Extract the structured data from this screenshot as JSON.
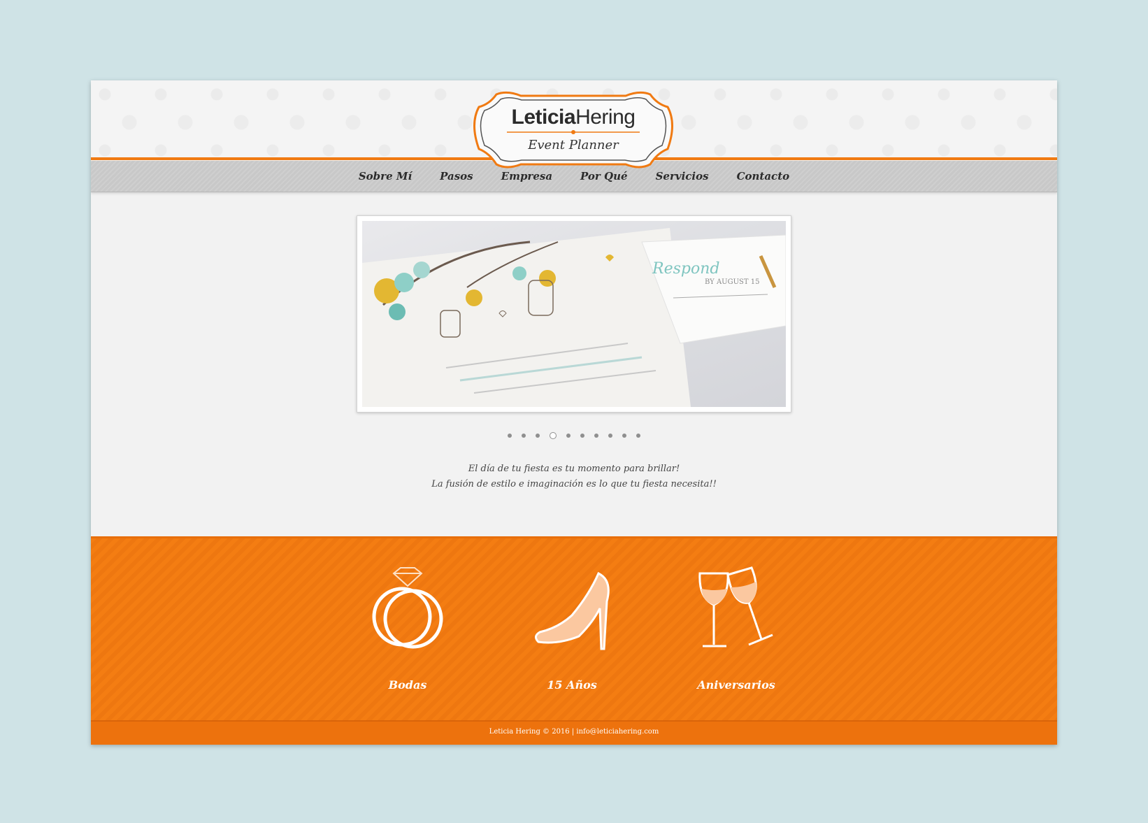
{
  "brand": {
    "name_bold": "Leticia",
    "name_light": "Hering",
    "subtitle": "Event Planner",
    "accent_color": "#f07a12"
  },
  "nav": {
    "items": [
      {
        "label": "Sobre Mí"
      },
      {
        "label": "Pasos"
      },
      {
        "label": "Empresa"
      },
      {
        "label": "Por Qué"
      },
      {
        "label": "Servicios"
      },
      {
        "label": "Contacto"
      }
    ]
  },
  "slider": {
    "dot_count": 10,
    "active_index": 3,
    "image_text": {
      "respond": "Respond",
      "by_line": "BY AUGUST 15"
    }
  },
  "tagline": {
    "line1": "El día de tu fiesta es tu momento para brillar!",
    "line2": "La fusión de estilo e imaginación es lo que tu fiesta necesita!!"
  },
  "categories": [
    {
      "label": "Bodas",
      "icon": "wedding-rings-icon"
    },
    {
      "label": "15 Años",
      "icon": "high-heel-icon"
    },
    {
      "label": "Aniversarios",
      "icon": "wine-glasses-icon"
    }
  ],
  "footer": {
    "copyright": "Leticia Hering © 2016 | ",
    "email": "info@leticiahering.com"
  }
}
